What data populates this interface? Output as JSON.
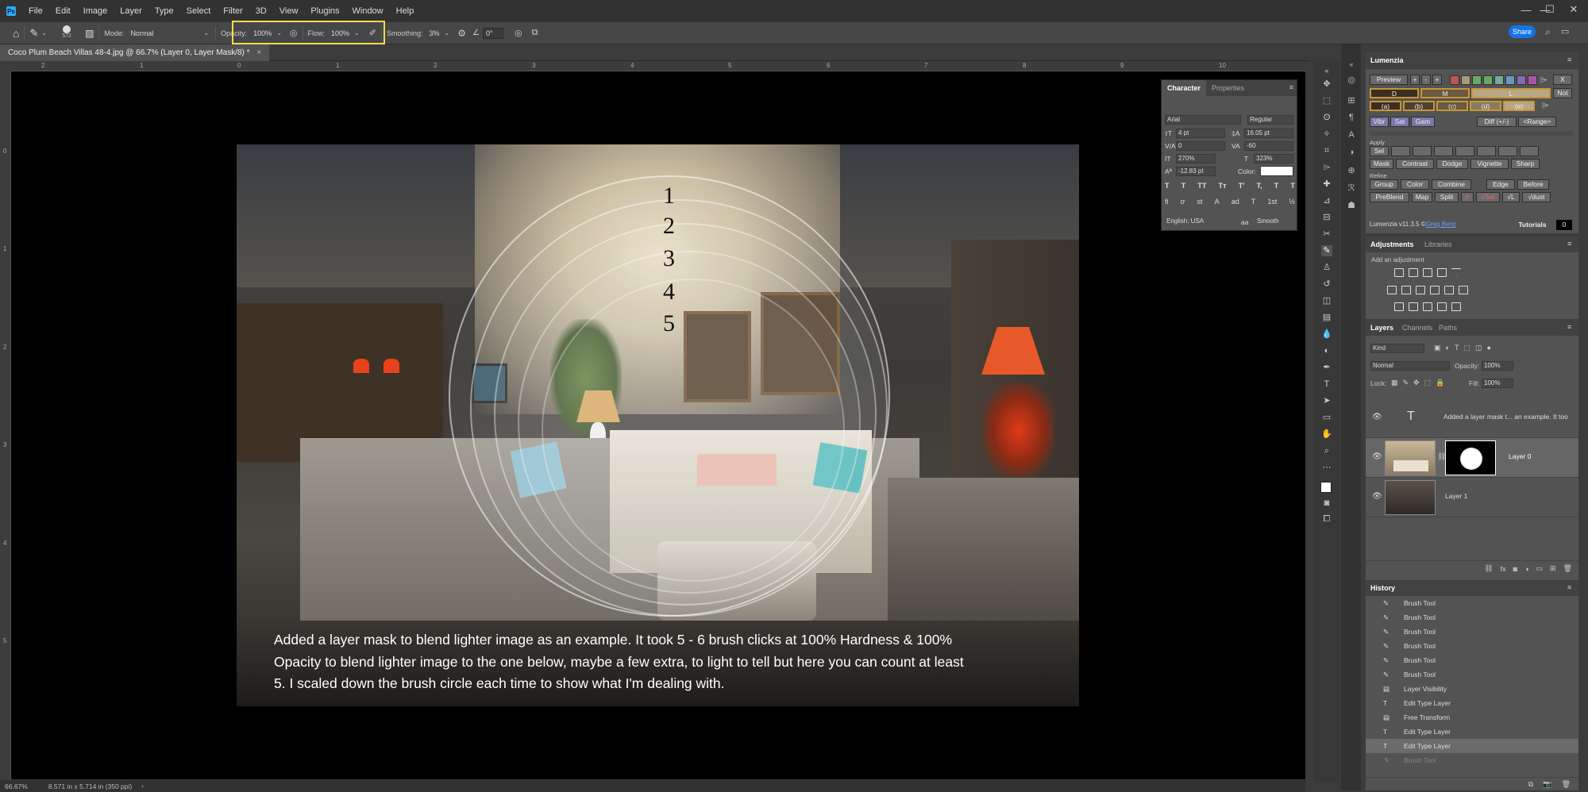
{
  "app": {
    "logo": "Ps"
  },
  "menubar": {
    "items": [
      "File",
      "Edit",
      "Image",
      "Layer",
      "Type",
      "Select",
      "Filter",
      "3D",
      "View",
      "Plugins",
      "Window",
      "Help"
    ]
  },
  "window_controls": {
    "minimize": "—",
    "maximize": "☐",
    "close": "✕"
  },
  "options": {
    "brush_size": "572",
    "mode_label": "Mode:",
    "mode_value": "Normal",
    "opacity_label": "Opacity:",
    "opacity_value": "100%",
    "flow_label": "Flow:",
    "flow_value": "100%",
    "smoothing_label": "Smoothing:",
    "smoothing_value": "3%",
    "angle_value": "0°",
    "share_label": "Share",
    "highlight_color": "#f2dd4a"
  },
  "document": {
    "tab_title": "Coco Plum Beach Villas 48-4.jpg @ 66.7% (Layer 0, Layer Mask/8) *",
    "close": "×"
  },
  "ruler": {
    "top": [
      "2",
      "1",
      "0",
      "1",
      "2",
      "3",
      "4",
      "5",
      "6",
      "7",
      "8",
      "9",
      "10"
    ],
    "left": [
      "0",
      "1",
      "2",
      "3",
      "4",
      "5"
    ]
  },
  "canvas": {
    "numbers": [
      "1",
      "2",
      "3",
      "4",
      "5"
    ],
    "caption": "Added a layer mask to blend lighter image as an example. It took 5 - 6 brush clicks at 100% Hardness & 100% Opacity to blend lighter image to the one below, maybe a few extra, to light to tell but here you can count at least 5. I scaled down the brush circle each time to show what I'm dealing with."
  },
  "status": {
    "zoom": "66.67%",
    "doc_size": "8.571 in x 5.714 in (350 ppi)"
  },
  "character_panel": {
    "tabs": [
      "Character",
      "Properties"
    ],
    "font_family": "Arial",
    "font_style": "Regular",
    "font_size": "4 pt",
    "leading": "16.05 pt",
    "kerning": "0",
    "tracking": "-60",
    "vertical_scale": "270%",
    "horizontal_scale": "323%",
    "baseline_shift": "-12.83 pt",
    "color_label": "Color:",
    "language": "English: USA",
    "antialias_label": "aa",
    "antialias": "Smooth",
    "style_buttons": [
      "T",
      "T",
      "TT",
      "Tт",
      "T'",
      "T,",
      "T",
      "T"
    ],
    "glyph_buttons": [
      "fi",
      "ơ",
      "st",
      "A",
      "ad",
      "T",
      "1st",
      "½"
    ]
  },
  "lumenzia": {
    "title": "Lumenzia",
    "preview": "Preview",
    "small_buttons": [
      "+",
      "-",
      "+"
    ],
    "swatches": [
      "#b55",
      "#a97",
      "#6a6",
      "#6a6",
      "#7a9",
      "#69b",
      "#86b",
      "#a5a"
    ],
    "x": "X",
    "zones": [
      "D",
      "M",
      "L"
    ],
    "not": "Not",
    "letters": [
      "(a)",
      "(b)",
      "(c)",
      "(d)",
      "(e)"
    ],
    "vibr": "Vibr",
    "sat": "Sat",
    "gam": "Gam",
    "diff": "Diff (+/-)",
    "range": "<Range>",
    "apply_label": "Apply",
    "sel": "Sel",
    "apply_row2": [
      "Mask",
      "Contrast",
      "Dodge",
      "Vignette",
      "Sharp"
    ],
    "refine_label": "Refine",
    "refine_row1": [
      "Group",
      "Color",
      "Combine",
      "Edge",
      "Before"
    ],
    "refine_row2": [
      "PreBlend",
      "Map",
      "Split",
      "//",
      "√Sel",
      "√L",
      "√dust"
    ],
    "version": "Lumenzia v11.3.5 ©",
    "author": "Greg Benz",
    "tutorials": "Tutorials",
    "counter": "0"
  },
  "adjustments": {
    "tabs": [
      "Adjustments",
      "Libraries"
    ],
    "hint": "Add an adjustment"
  },
  "layers": {
    "tabs": [
      "Layers",
      "Channels",
      "Paths"
    ],
    "kind": "Kind",
    "blend": "Normal",
    "opacity_label": "Opacity:",
    "opacity": "100%",
    "lock_label": "Lock:",
    "fill_label": "Fill:",
    "fill": "100%",
    "rows": [
      {
        "name": "Added a layer mask t... an example. It too"
      },
      {
        "name": "Layer 0"
      },
      {
        "name": "Layer 1"
      }
    ],
    "bottom_icons": [
      "link",
      "fx",
      "mask",
      "adjust",
      "group",
      "new",
      "delete"
    ]
  },
  "history": {
    "title": "History",
    "rows": [
      "Brush Tool",
      "Brush Tool",
      "Brush Tool",
      "Brush Tool",
      "Brush Tool",
      "Brush Tool",
      "Layer Visibility",
      "Edit Type Layer",
      "Free Transform",
      "Edit Type Layer",
      "Edit Type Layer",
      "Brush Tool"
    ]
  }
}
